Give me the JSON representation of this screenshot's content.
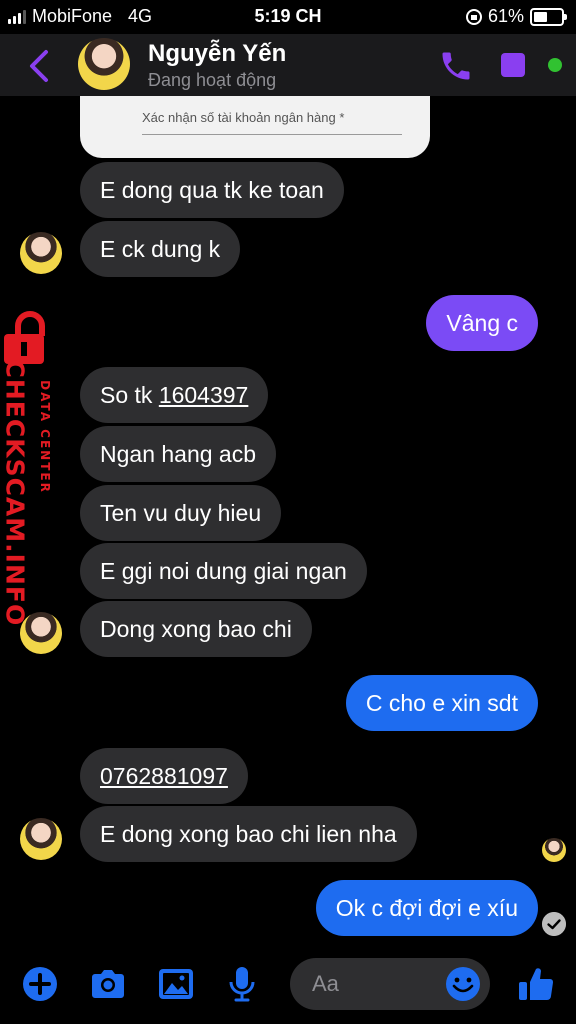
{
  "status_bar": {
    "carrier": "MobiFone",
    "network": "4G",
    "time": "5:19 CH",
    "battery": "61%",
    "battery_level": 0.61,
    "signal_bars": 3
  },
  "header": {
    "name": "Nguyễn Yến",
    "status": "Đang hoạt động"
  },
  "form_card": {
    "label": "Xác nhận số tài khoản ngân hàng *"
  },
  "messages": [
    {
      "text": "E dong qua tk ke toan",
      "dir": "in"
    },
    {
      "text": "E ck dung k",
      "dir": "in"
    },
    {
      "text": "Vâng c",
      "dir": "out"
    },
    {
      "text": "So tk ",
      "link": "1604397",
      "dir": "in"
    },
    {
      "text": "Ngan hang acb",
      "dir": "in"
    },
    {
      "text": "Ten vu duy hieu",
      "dir": "in"
    },
    {
      "text": "E ggi noi dung giai ngan",
      "dir": "in"
    },
    {
      "text": "Dong xong bao chi",
      "dir": "in"
    },
    {
      "text": "C cho e xin sdt",
      "dir": "out"
    },
    {
      "link": "0762881097",
      "dir": "in"
    },
    {
      "text": "E dong xong bao chi lien nha",
      "dir": "in"
    },
    {
      "text": "Ok c đợi đợi e xíu",
      "dir": "out"
    }
  ],
  "watermark": {
    "brand": "CHECKSCAM.INFO",
    "sub": "DATA CENTER"
  },
  "composer": {
    "placeholder": "Aa"
  },
  "colors": {
    "accent_purple": "#7b4bf5",
    "accent_blue": "#1e6cf0",
    "incoming_bubble": "#2e2e30",
    "watermark_red": "#e31b23",
    "online_green": "#31c231"
  },
  "icons": [
    "back-chevron-icon",
    "phone-icon",
    "video-camera-icon",
    "plus-icon",
    "camera-icon",
    "image-icon",
    "microphone-icon",
    "emoji-icon",
    "thumbs-up-icon",
    "lock-icon",
    "check-icon"
  ]
}
